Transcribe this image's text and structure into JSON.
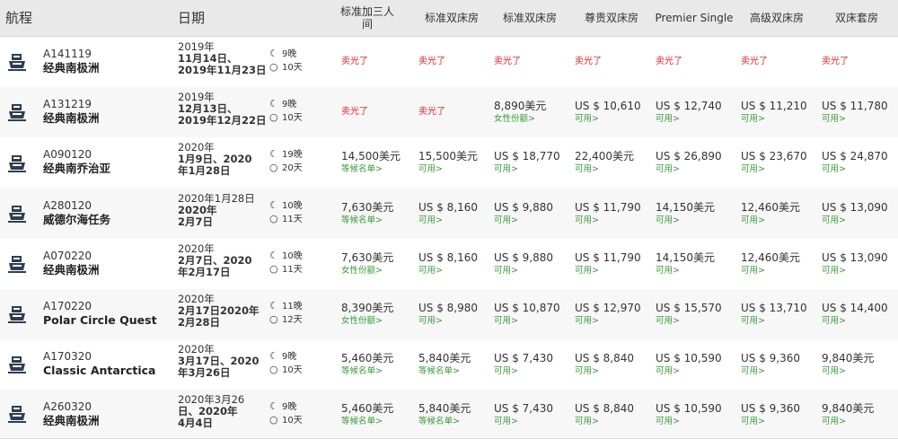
{
  "header": {
    "route": "航程",
    "date": "日期",
    "cabins": [
      "标准加三人间",
      "标准双床房",
      "标准双床房",
      "尊贵双床房",
      "Premier Single",
      "高级双床房",
      "双床套房"
    ]
  },
  "rows": [
    {
      "code": "A141119",
      "name": "经典南极洲",
      "date": [
        "2019年",
        "11月14日、",
        "2019年11月23日"
      ],
      "nights": "9晚",
      "days": "10天",
      "cells": [
        {
          "soldout": "卖光了"
        },
        {
          "soldout": "卖光了"
        },
        {
          "soldout": "卖光了"
        },
        {
          "soldout": "卖光了"
        },
        {
          "soldout": "卖光了"
        },
        {
          "soldout": "卖光了"
        },
        {
          "soldout": "卖光了"
        }
      ]
    },
    {
      "code": "A131219",
      "name": "经典南极洲",
      "date": [
        "2019年",
        "12月13日、",
        "2019年12月22日"
      ],
      "nights": "9晚",
      "days": "10天",
      "cells": [
        {
          "soldout": "卖光了"
        },
        {
          "soldout": "卖光了"
        },
        {
          "price": "8,890美元",
          "status": "女性份额>"
        },
        {
          "price": "US $ 10,610",
          "status": "可用>"
        },
        {
          "price": "US $ 12,740",
          "status": "可用>"
        },
        {
          "price": "US $ 11,210",
          "status": "可用>"
        },
        {
          "price": "US $ 11,780",
          "status": "可用>"
        }
      ]
    },
    {
      "code": "A090120",
      "name": "经典南乔治亚",
      "date": [
        "2020年",
        "1月9日、2020",
        "年1月28日"
      ],
      "nights": "19晚",
      "days": "20天",
      "cells": [
        {
          "price": "14,500美元",
          "status": "等候名单>"
        },
        {
          "price": "15,500美元",
          "status": "可用>"
        },
        {
          "price": "US $ 18,770",
          "status": "可用>"
        },
        {
          "price": "22,400美元",
          "status": "可用>"
        },
        {
          "price": "US $ 26,890",
          "status": "可用>"
        },
        {
          "price": "US $ 23,670",
          "status": "可用>"
        },
        {
          "price": "US $ 24,870",
          "status": "可用>"
        }
      ]
    },
    {
      "code": "A280120",
      "name": "威德尔海任务",
      "date": [
        "2020年1月28日",
        "2020年",
        "2月7日"
      ],
      "nights": "10晚",
      "days": "11天",
      "cells": [
        {
          "price": "7,630美元",
          "status": "等候名单>"
        },
        {
          "price": "US $ 8,160",
          "status": "可用>"
        },
        {
          "price": "US $ 9,880",
          "status": "可用>"
        },
        {
          "price": "US $ 11,790",
          "status": "可用>"
        },
        {
          "price": "14,150美元",
          "status": "可用>"
        },
        {
          "price": "12,460美元",
          "status": "可用>"
        },
        {
          "price": "US $ 13,090",
          "status": "可用>"
        }
      ]
    },
    {
      "code": "A070220",
      "name": "经典南极洲",
      "date": [
        "2020年",
        "2月7日、2020",
        "年2月17日"
      ],
      "nights": "10晚",
      "days": "11天",
      "cells": [
        {
          "price": "7,630美元",
          "status": "女性份额>"
        },
        {
          "price": "US $ 8,160",
          "status": "可用>"
        },
        {
          "price": "US $ 9,880",
          "status": "可用>"
        },
        {
          "price": "US $ 11,790",
          "status": "可用>"
        },
        {
          "price": "14,150美元",
          "status": "可用>"
        },
        {
          "price": "12,460美元",
          "status": "可用>"
        },
        {
          "price": "US $ 13,090",
          "status": "可用>"
        }
      ]
    },
    {
      "code": "A170220",
      "name": "Polar Circle Quest",
      "date": [
        "2020年",
        "2月17日2020年",
        "2月28日"
      ],
      "nights": "11晚",
      "days": "12天",
      "cells": [
        {
          "price": "8,390美元",
          "status": "女性份额>"
        },
        {
          "price": "US $ 8,980",
          "status": "可用>"
        },
        {
          "price": "US $ 10,870",
          "status": "可用>"
        },
        {
          "price": "US $ 12,970",
          "status": "可用>"
        },
        {
          "price": "US $ 15,570",
          "status": "可用>"
        },
        {
          "price": "US $ 13,710",
          "status": "可用>"
        },
        {
          "price": "US $ 14,400",
          "status": "可用>"
        }
      ]
    },
    {
      "code": "A170320",
      "name": "Classic Antarctica",
      "date": [
        "2020年",
        "3月17日、2020",
        "年3月26日"
      ],
      "nights": "9晚",
      "days": "10天",
      "cells": [
        {
          "price": "5,460美元",
          "status": "等候名单>"
        },
        {
          "price": "5,840美元",
          "status": "等候名单>"
        },
        {
          "price": "US $ 7,430",
          "status": "可用>"
        },
        {
          "price": "US $ 8,840",
          "status": "可用>"
        },
        {
          "price": "US $ 10,590",
          "status": "可用>"
        },
        {
          "price": "US $ 9,360",
          "status": "可用>"
        },
        {
          "price": "9,840美元",
          "status": "可用>"
        }
      ]
    },
    {
      "code": "A260320",
      "name": "经典南极洲",
      "date": [
        "2020年3月26",
        "日、2020年",
        "4月4日"
      ],
      "nights": "9晚",
      "days": "10天",
      "cells": [
        {
          "price": "5,460美元",
          "status": "等候名单>"
        },
        {
          "price": "5,840美元",
          "status": "等候名单>"
        },
        {
          "price": "US $ 7,430",
          "status": "可用>"
        },
        {
          "price": "US $ 8,840",
          "status": "可用>"
        },
        {
          "price": "US $ 10,590",
          "status": "可用>"
        },
        {
          "price": "US $ 9,360",
          "status": "可用>"
        },
        {
          "price": "9,840美元",
          "status": "可用>"
        }
      ]
    }
  ]
}
